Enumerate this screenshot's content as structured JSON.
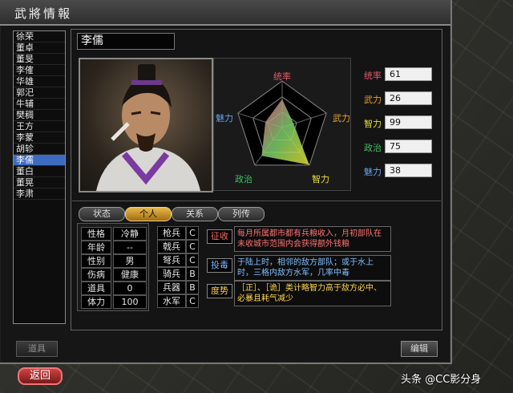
{
  "window": {
    "title": "武將情報"
  },
  "officer_list": [
    "徐荣",
    "董卓",
    "董旻",
    "李傕",
    "华雄",
    "郭汜",
    "牛辅",
    "樊稠",
    "王方",
    "李蒙",
    "胡轸",
    "李儒",
    "董白",
    "董晃",
    "李肃"
  ],
  "selected_index": 11,
  "officer": {
    "name": "李儒"
  },
  "radar": {
    "labels": {
      "top": "统率",
      "right": "武力",
      "bottom_right": "智力",
      "bottom_left": "政治",
      "left": "魅力"
    },
    "values": {
      "统率": 61,
      "武力": 26,
      "智力": 99,
      "政治": 75,
      "魅力": 38
    },
    "max": 100
  },
  "stats": [
    {
      "label": "统率",
      "value": "61",
      "color": "#e85a6a"
    },
    {
      "label": "武力",
      "value": "26",
      "color": "#e0a030"
    },
    {
      "label": "智力",
      "value": "99",
      "color": "#e8e030"
    },
    {
      "label": "政治",
      "value": "75",
      "color": "#40c060"
    },
    {
      "label": "魅力",
      "value": "38",
      "color": "#6aa0e8"
    }
  ],
  "tabs": [
    {
      "label": "状态",
      "active": false
    },
    {
      "label": "个人",
      "active": true
    },
    {
      "label": "关系",
      "active": false
    },
    {
      "label": "列传",
      "active": false
    }
  ],
  "personal": [
    {
      "label": "性格",
      "value": "冷静"
    },
    {
      "label": "年龄",
      "value": "--"
    },
    {
      "label": "性别",
      "value": "男"
    },
    {
      "label": "伤病",
      "value": "健康"
    },
    {
      "label": "道具",
      "value": "0"
    },
    {
      "label": "体力",
      "value": "100"
    }
  ],
  "troops": [
    {
      "label": "枪兵",
      "value": "C"
    },
    {
      "label": "戟兵",
      "value": "C"
    },
    {
      "label": "弩兵",
      "value": "C"
    },
    {
      "label": "骑兵",
      "value": "B"
    },
    {
      "label": "兵器",
      "value": "B"
    },
    {
      "label": "水军",
      "value": "C"
    }
  ],
  "skills": [
    {
      "name": "征收",
      "name_color": "#ff6a6a",
      "desc": "每月所属都市都有兵粮收入，月初部队在未收城市范围内会获得额外钱粮",
      "desc_color": "#ff7070"
    },
    {
      "name": "投毒",
      "name_color": "#7ab8ff",
      "desc": "于陆上时，相邻的敌方部队；或于水上时，三格内敌方水军，几率中毒",
      "desc_color": "#80c0ff"
    },
    {
      "name": "度势",
      "name_color": "#ffd84a",
      "desc": "［正］、［诡］类计略智力高于敌方必中、必暴且耗气减少",
      "desc_color": "#ffd84a"
    }
  ],
  "buttons": {
    "items": "道具",
    "edit": "编辑",
    "back": "返回"
  },
  "watermark": "头条 @CC影分身"
}
